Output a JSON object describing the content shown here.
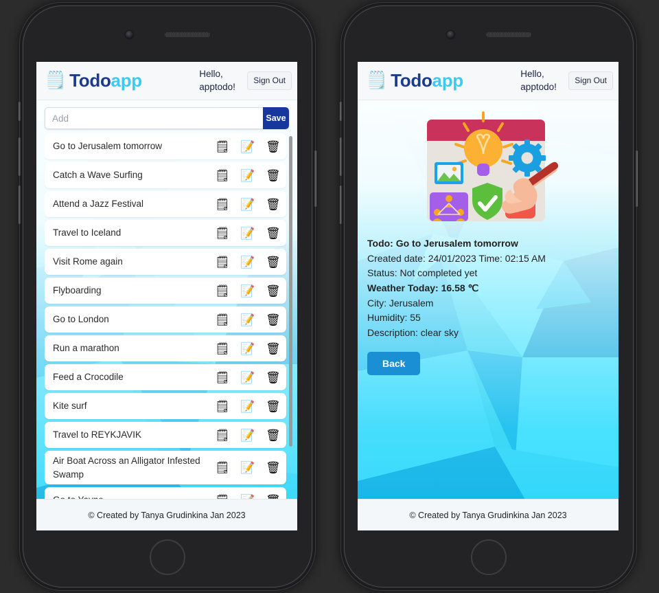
{
  "header": {
    "brand_icon": "notepad-pen-icon",
    "brand_part1": "Todo",
    "brand_part2": "app",
    "greeting": "Hello, apptodo!",
    "signout_label": "Sign Out"
  },
  "add_form": {
    "placeholder": "Add",
    "value": "",
    "save_label": "Save"
  },
  "todos": [
    {
      "title": "Go to Jerusalem tomorrow"
    },
    {
      "title": "Catch a Wave Surfing"
    },
    {
      "title": "Attend a Jazz Festival"
    },
    {
      "title": "Travel to Iceland"
    },
    {
      "title": "Visit Rome again"
    },
    {
      "title": "Flyboarding"
    },
    {
      "title": "Go to London"
    },
    {
      "title": "Run a marathon"
    },
    {
      "title": "Feed a Crocodile"
    },
    {
      "title": "Kite surf"
    },
    {
      "title": "Travel to REYKJAVIK"
    },
    {
      "title": "Air Boat Across an Alligator Infested Swamp"
    },
    {
      "title": "Go to Yavne"
    }
  ],
  "todo_actions": {
    "notes_icon": "🗒",
    "edit_icon": "📝",
    "delete_icon": "🗑",
    "notes_name": "notes-icon",
    "edit_name": "edit-icon",
    "delete_name": "delete-icon"
  },
  "detail": {
    "todo_line": "Todo: Go to Jerusalem tomorrow",
    "created_line": "Created date: 24/01/2023 Time: 02:15 AM",
    "status_line": "Status: Not completed yet",
    "weather_line": "Weather Today: 16.58 ℃",
    "city_line": "City: Jerusalem",
    "humidity_line": "Humidity: 55",
    "description_line": "Description: clear sky",
    "back_label": "Back",
    "illustration_name": "creative-workspace-illustration"
  },
  "footer": {
    "text": "© Created by Tanya Grudinkina Jan 2023"
  },
  "colors": {
    "brand_dark": "#1d3b8b",
    "brand_light": "#3ec9f0",
    "save_button": "#17379e",
    "back_button": "#1b8fd4",
    "background_cyan": "#2ad4f5",
    "page_background": "#2c2c2c"
  }
}
